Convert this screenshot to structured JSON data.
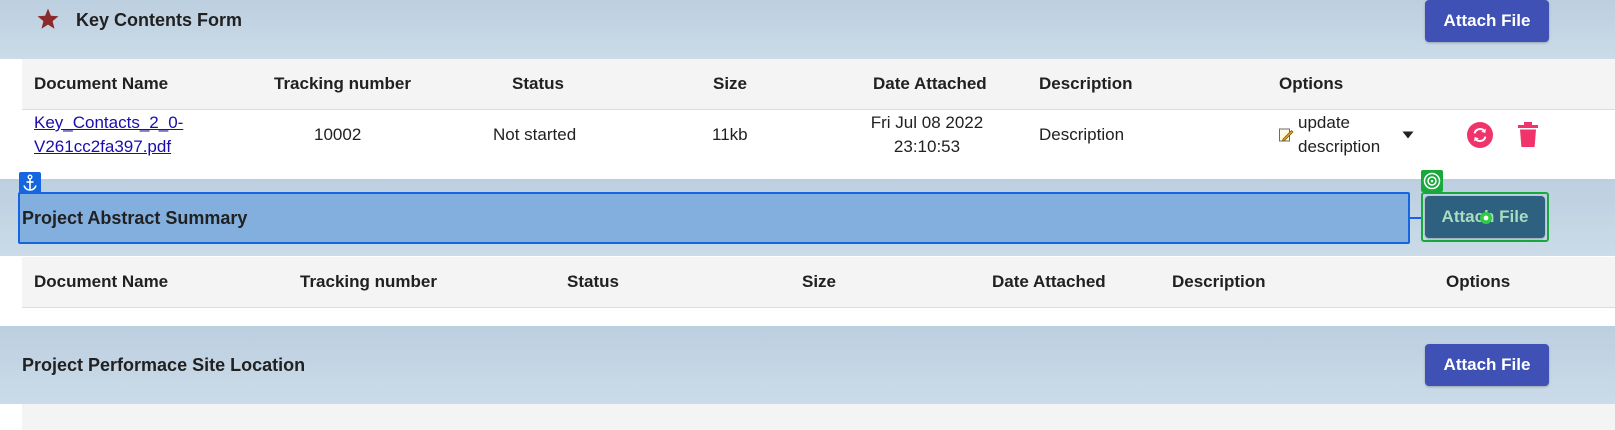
{
  "sections": [
    {
      "title": "Key Contents Form",
      "attach_label": "Attach File",
      "columns": [
        "Document Name",
        "Tracking number",
        "Status",
        "Size",
        "Date Attached",
        "Description",
        "Options"
      ],
      "rows": [
        {
          "document_name_line1": "Key_Contacts_2_0-",
          "document_name_line2": "V261cc2fa397.pdf",
          "tracking_number": "10002",
          "status": "Not started",
          "size": "11kb",
          "date_line1": "Fri Jul 08 2022",
          "date_line2": "23:10:53",
          "description": "Description",
          "option_line1": "update",
          "option_line2": "description"
        }
      ]
    },
    {
      "title": "Project Abstract Summary",
      "attach_label": "Attach File",
      "columns": [
        "Document Name",
        "Tracking number",
        "Status",
        "Size",
        "Date Attached",
        "Description",
        "Options"
      ]
    },
    {
      "title": "Project Performace Site Location",
      "attach_label": "Attach File"
    }
  ],
  "icons": {
    "star": "star-icon",
    "edit": "edit-icon",
    "dropdown": "caret-down-icon",
    "sync": "sync-icon",
    "delete": "trash-icon",
    "anchor": "anchor-icon",
    "target": "target-icon"
  },
  "colors": {
    "band": "#c3d5e4",
    "button": "#3f51b5",
    "star": "#8b2a2a",
    "link": "#1a0dab",
    "action_red": "#f0336b",
    "highlight_blue": "#1565e0",
    "highlight_green": "#18a83c"
  }
}
